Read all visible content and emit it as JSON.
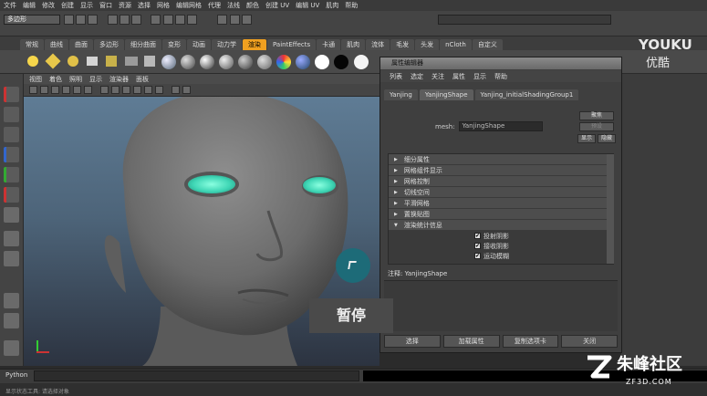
{
  "menu_bar": [
    "文件",
    "编辑",
    "修改",
    "创建",
    "显示",
    "窗口",
    "资源",
    "选择",
    "网格",
    "编辑网格",
    "代理",
    "法线",
    "颜色",
    "创建 UV",
    "编辑 UV",
    "肌肉",
    "帮助"
  ],
  "status_line": {
    "mode": "多边形"
  },
  "shelf_tabs": [
    {
      "label": "常规",
      "active": false
    },
    {
      "label": "曲线",
      "active": false
    },
    {
      "label": "曲面",
      "active": false
    },
    {
      "label": "多边形",
      "active": false
    },
    {
      "label": "细分曲面",
      "active": false
    },
    {
      "label": "变形",
      "active": false
    },
    {
      "label": "动画",
      "active": false
    },
    {
      "label": "动力学",
      "active": false
    },
    {
      "label": "渲染",
      "active": true
    },
    {
      "label": "PaintEffects",
      "active": false
    },
    {
      "label": "卡通",
      "active": false
    },
    {
      "label": "肌肉",
      "active": false
    },
    {
      "label": "流体",
      "active": false
    },
    {
      "label": "毛发",
      "active": false
    },
    {
      "label": "头发",
      "active": false
    },
    {
      "label": "nCloth",
      "active": false
    },
    {
      "label": "自定义",
      "active": false
    }
  ],
  "viewport_menu": [
    "视图",
    "着色",
    "照明",
    "显示",
    "渲染器",
    "面板"
  ],
  "attribute_editor": {
    "title": "属性编辑器",
    "menu": [
      "列表",
      "选定",
      "关注",
      "属性",
      "显示",
      "帮助"
    ],
    "tabs": [
      {
        "label": "Yanjing",
        "active": false
      },
      {
        "label": "YanjingShape",
        "active": true
      },
      {
        "label": "Yanjing_initialShadingGroup1",
        "active": false
      }
    ],
    "mesh_label": "mesh:",
    "mesh_value": "YanjingShape",
    "focus_button": "聚焦",
    "preset_button": "预设",
    "show_button": "显示",
    "hide_button": "隐藏",
    "sections": [
      "细分属性",
      "网格组件显示",
      "网格控制",
      "切线空间",
      "平滑网格",
      "置换贴图",
      "渲染统计信息"
    ],
    "checkboxes": [
      "投射阴影",
      "接收阴影",
      "运动模糊"
    ],
    "note": "注释: YanjingShape",
    "buttons": [
      "选择",
      "加载属性",
      "复制选项卡",
      "关闭"
    ]
  },
  "pause_overlay": "暂停",
  "command_line": {
    "label": "Python"
  },
  "help_line": "显示状态工具: 请选择对象",
  "watermarks": {
    "youku": "YOUKU",
    "youku_cn": "优酷",
    "zf_name": "朱峰社区",
    "zf_url": "ZF3D.COM"
  },
  "colors": {
    "accent_tab": "#f0a020",
    "eye_highlight": "#3fd6b5",
    "cursor_circle": "#1d6b78"
  }
}
